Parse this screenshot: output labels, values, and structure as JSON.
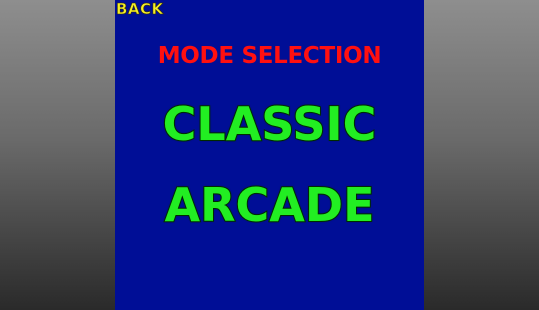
{
  "header": {
    "back_label": "BACK"
  },
  "screen": {
    "title": "MODE SELECTION",
    "modes": [
      {
        "label": "CLASSIC"
      },
      {
        "label": "ARCADE"
      }
    ]
  },
  "colors": {
    "panel_background": "#000e96",
    "title": "#ff1010",
    "mode_label": "#22ee22",
    "back_label": "#f4ee2a"
  }
}
